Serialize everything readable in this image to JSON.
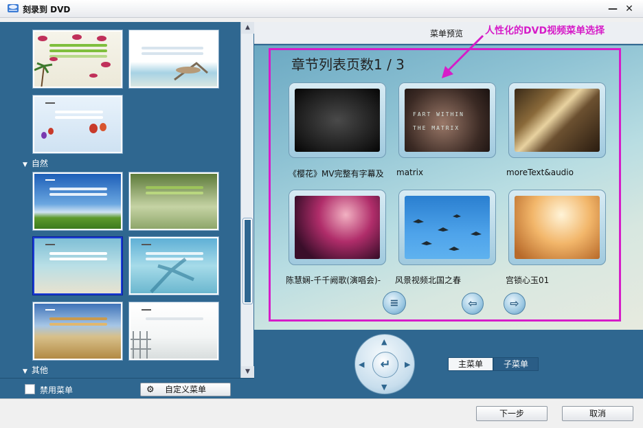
{
  "window": {
    "title": "刻录到 DVD",
    "minimize_label": "—",
    "close_label": "✕"
  },
  "left_panel": {
    "categories": [
      {
        "label": "自然"
      },
      {
        "label": "其他"
      }
    ],
    "disable_menu_label": "禁用菜单",
    "disable_menu_checked": false,
    "custom_menu_label": "自定义菜单"
  },
  "preview": {
    "header_label": "菜单预览",
    "annotation": "人性化的DVD视频菜单选择",
    "page_title": "章节列表页数1 / 3",
    "clips": [
      {
        "label": "《樱花》MV完整有字幕及"
      },
      {
        "label": "matrix",
        "screen_text": "FART WITHIN THE MATRIX"
      },
      {
        "label": "moreText&audio"
      },
      {
        "label": "陈慧娴-千千阙歌(演唱会)-"
      },
      {
        "label": "风景视频北国之春"
      },
      {
        "label": "宫锁心玉01"
      }
    ],
    "nav": {
      "home_icon": "≡",
      "prev_icon": "⇦",
      "next_icon": "⇨"
    }
  },
  "controls": {
    "main_menu_label": "主菜单",
    "sub_menu_label": "子菜单",
    "active": "sub"
  },
  "footer": {
    "next_label": "下一步",
    "cancel_label": "取消"
  },
  "colors": {
    "panel_bg": "#2f6790",
    "frame_accent": "#d61cc8",
    "selected_border": "#1a3cd6"
  }
}
